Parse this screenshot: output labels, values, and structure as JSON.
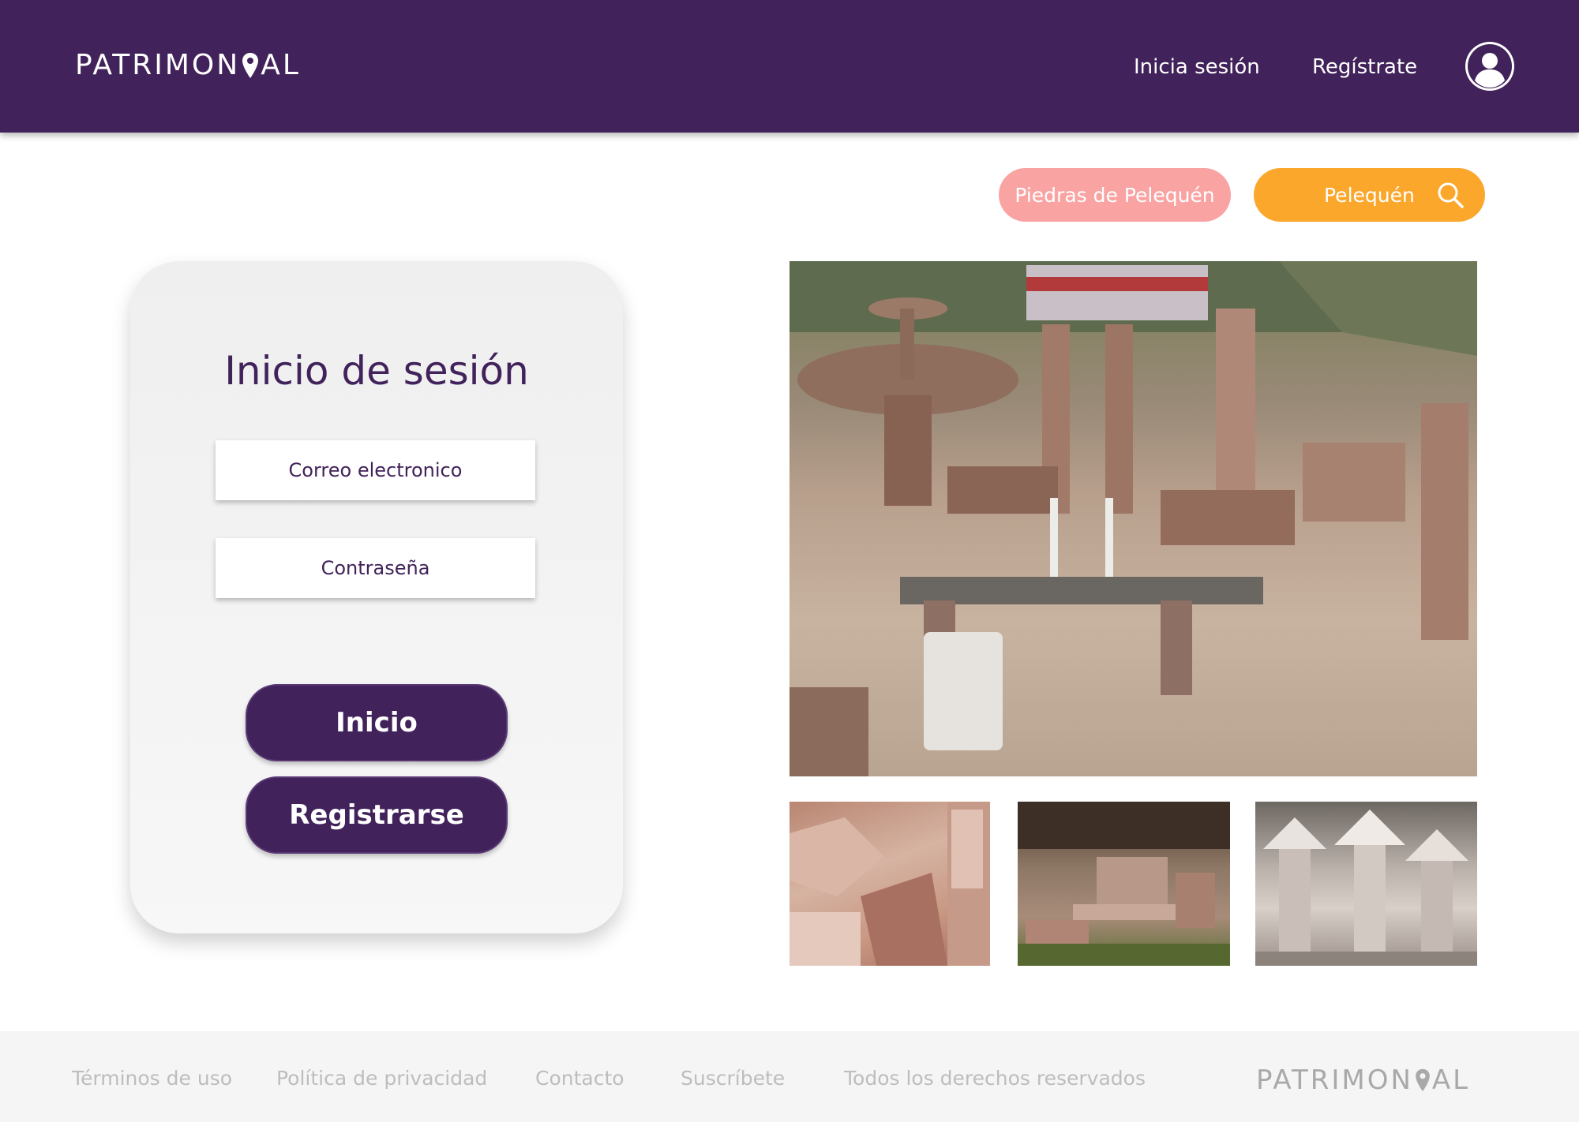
{
  "header": {
    "logo_part1": "PATRIMON",
    "logo_part2": "AL",
    "login_link": "Inicia sesión",
    "register_link": "Regístrate"
  },
  "search": {
    "tag_label": "Piedras de Pelequén",
    "query": "Pelequén"
  },
  "login_card": {
    "title": "Inicio de sesión",
    "email_placeholder": "Correo electronico",
    "password_placeholder": "Contraseña",
    "login_button": "Inicio",
    "register_button": "Registrarse"
  },
  "footer": {
    "links": [
      "Términos de uso",
      "Política de privacidad",
      "Contacto",
      "Suscríbete",
      "Todos los derechos reservados"
    ],
    "logo_part1": "PATRIMON",
    "logo_part2": "AL"
  },
  "colors": {
    "primary": "#41225a",
    "tag_pink": "#f9a3a3",
    "search_orange": "#fba72b",
    "footer_bg": "#f5f5f5"
  },
  "icons": [
    "location-pin-icon",
    "user-avatar-icon",
    "search-icon"
  ]
}
